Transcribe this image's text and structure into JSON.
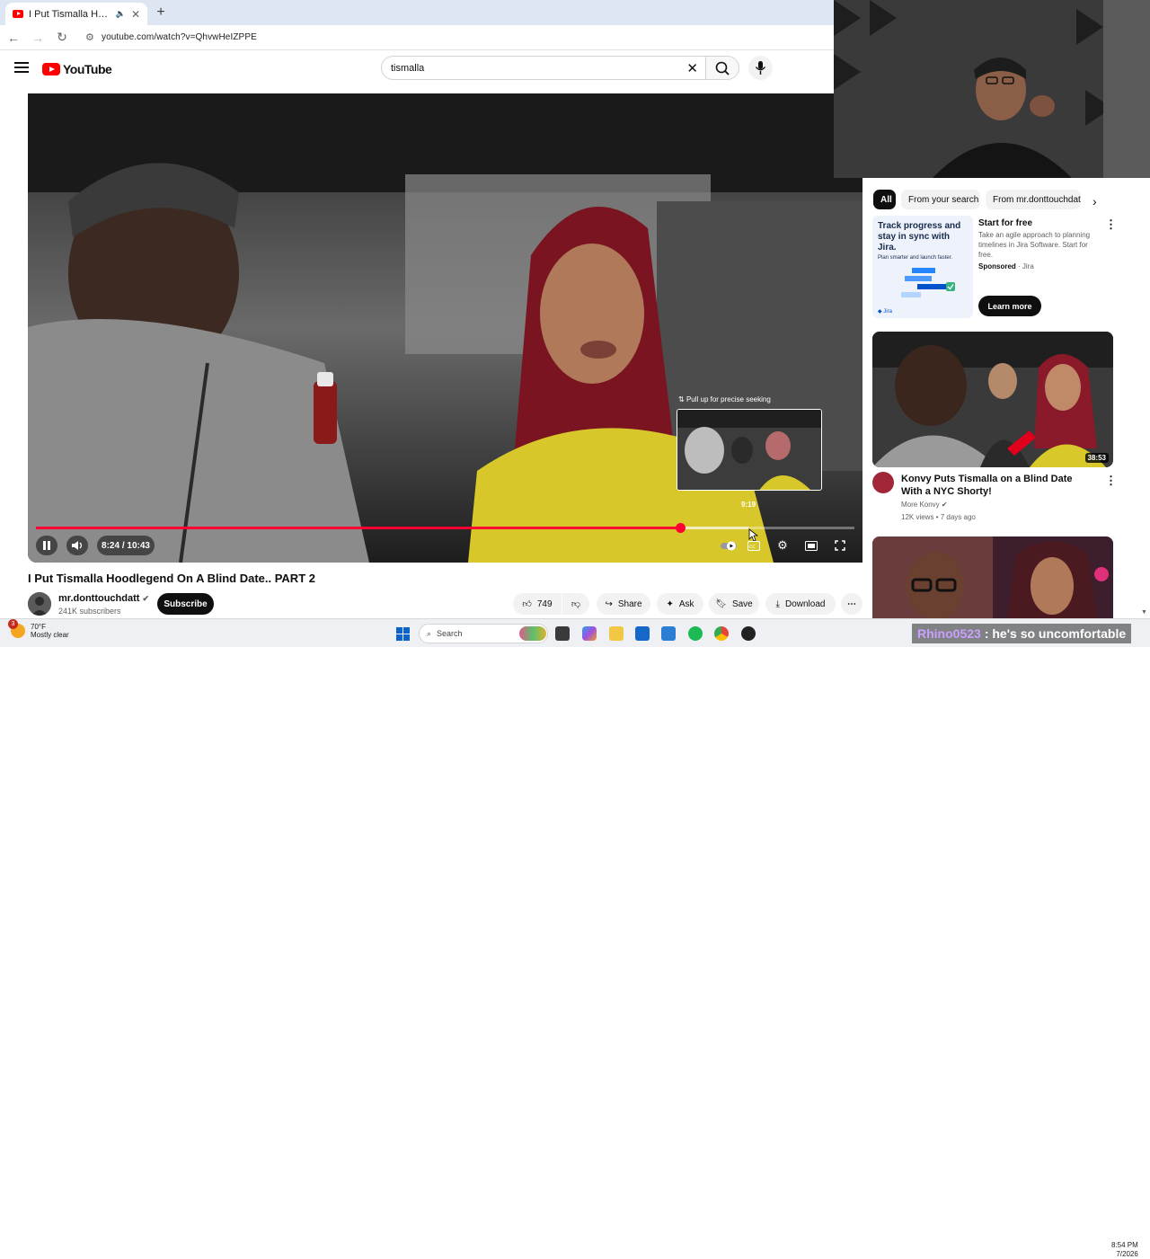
{
  "browser": {
    "tab_title": "I Put Tismalla Hoodlegend",
    "url": "youtube.com/watch?v=QhvwHeIZPPE"
  },
  "header": {
    "logo_text": "YouTube",
    "search_value": "tismalla"
  },
  "player": {
    "tooltip": "Pull up for precise seeking",
    "preview_time": "9:19",
    "time_display": "8:24 / 10:43",
    "progress_played": 0.787,
    "progress_buffered": 0.87
  },
  "video": {
    "title": "I Put Tismalla Hoodlegend On A Blind Date.. PART 2",
    "channel": "mr.donttouchdatt",
    "subscribers": "241K subscribers",
    "subscribe_label": "Subscribe",
    "likes": "749",
    "share_label": "Share",
    "ask_label": "Ask",
    "save_label": "Save",
    "download_label": "Download"
  },
  "sidebar": {
    "chips": [
      "All",
      "From your search",
      "From mr.donttouchdatt"
    ],
    "ad": {
      "image_headline": "Track progress and stay in sync with Jira.",
      "image_sub": "Plan smarter and launch faster.",
      "image_brand": "Jira",
      "title": "Start for free",
      "description": "Take an agile approach to planning timelines in Jira Software. Start for free.",
      "sponsored": "Sponsored",
      "advertiser": "Jira",
      "cta": "Learn more"
    },
    "videos": [
      {
        "title": "Konvy Puts Tismalla on a Blind Date With a NYC Shorty!",
        "channel": "More Konvy",
        "views": "12K views",
        "age": "7 days ago",
        "duration": "38:53"
      }
    ]
  },
  "taskbar": {
    "weather_temp": "70°F",
    "weather_desc": "Mostly clear",
    "weather_badge": "3",
    "search_label": "Search",
    "time": "8:54 PM",
    "date": "7/2026"
  },
  "overlay": {
    "chat_user": "Rhino0523",
    "chat_message": ": he's so uncomfortable"
  }
}
